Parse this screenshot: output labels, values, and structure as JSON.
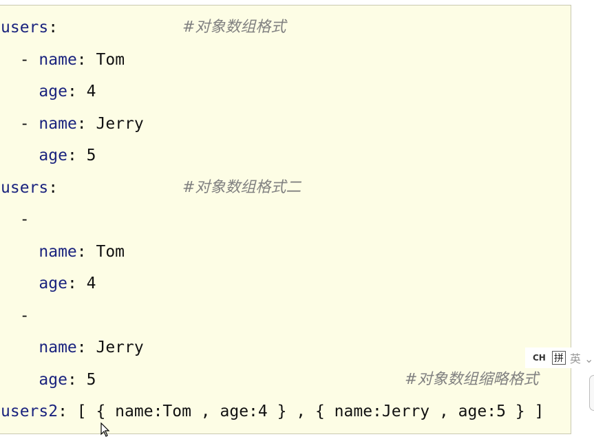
{
  "editor": {
    "lines": [
      {
        "key": "users",
        "sep": ":",
        "rest": ""
      },
      {
        "indent": "  ",
        "dash": "- ",
        "key": "name",
        "sep": ": ",
        "rest": "Tom"
      },
      {
        "indent": "    ",
        "key": "age",
        "sep": ": ",
        "rest": "4"
      },
      {
        "indent": "  ",
        "dash": "- ",
        "key": "name",
        "sep": ": ",
        "rest": "Jerry"
      },
      {
        "indent": "    ",
        "key": "age",
        "sep": ": ",
        "rest": "5"
      },
      {
        "key": "users",
        "sep": ":",
        "rest": ""
      },
      {
        "indent": "  ",
        "dash": "-",
        "key": "",
        "sep": "",
        "rest": ""
      },
      {
        "indent": "    ",
        "key": "name",
        "sep": ": ",
        "rest": "Tom"
      },
      {
        "indent": "    ",
        "key": "age",
        "sep": ": ",
        "rest": "4"
      },
      {
        "indent": "  ",
        "dash": "-",
        "key": "",
        "sep": "",
        "rest": ""
      },
      {
        "indent": "    ",
        "key": "name",
        "sep": ": ",
        "rest": "Jerry"
      },
      {
        "indent": "    ",
        "key": "age",
        "sep": ": ",
        "rest": "5"
      },
      {
        "key": "users2",
        "sep": ": ",
        "rest": "[ { name:Tom , age:4 } , { name:Jerry , age:5 } ]"
      }
    ],
    "comments": [
      {
        "line": 0,
        "text": "#对象数组格式"
      },
      {
        "line": 5,
        "text": "#对象数组格式二"
      },
      {
        "line": 11,
        "text": "#对象数组缩略格式"
      }
    ]
  },
  "ime": {
    "lang": "CH",
    "mode": "拼",
    "extra": "英 ⌄"
  },
  "colors": {
    "background": "#fdfde5",
    "key": "#1a237e",
    "comment": "#808080"
  }
}
